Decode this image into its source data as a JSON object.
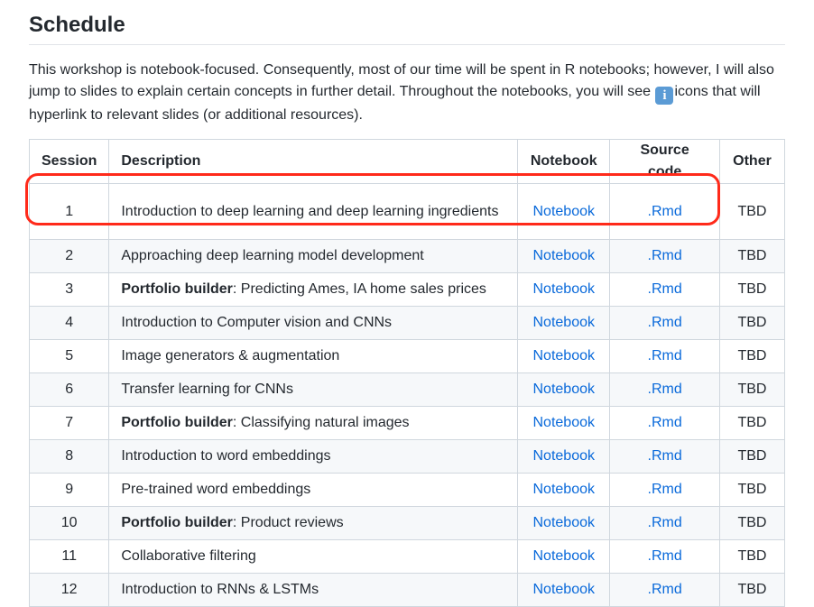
{
  "section": {
    "title": "Schedule"
  },
  "intro": {
    "text_before": "This workshop is notebook-focused. Consequently, most of our time will be spent in R notebooks; however, I will also jump to slides to explain certain concepts in further detail. Throughout the notebooks, you will see ",
    "icon": "info-icon",
    "icon_glyph": "i",
    "text_after": "icons that will hyperlink to relevant slides (or additional resources)."
  },
  "table": {
    "headers": {
      "session": "Session",
      "description": "Description",
      "notebook": "Notebook",
      "source": "Source code",
      "other": "Other"
    },
    "rows": [
      {
        "session": "1",
        "bold": "",
        "description": "Introduction to deep learning and deep learning ingredients",
        "notebook": "Notebook",
        "source": ".Rmd",
        "other": "TBD"
      },
      {
        "session": "2",
        "bold": "",
        "description": "Approaching deep learning model development",
        "notebook": "Notebook",
        "source": ".Rmd",
        "other": "TBD"
      },
      {
        "session": "3",
        "bold": "Portfolio builder",
        "description": ": Predicting Ames, IA home sales prices",
        "notebook": "Notebook",
        "source": ".Rmd",
        "other": "TBD"
      },
      {
        "session": "4",
        "bold": "",
        "description": "Introduction to Computer vision and CNNs",
        "notebook": "Notebook",
        "source": ".Rmd",
        "other": "TBD"
      },
      {
        "session": "5",
        "bold": "",
        "description": "Image generators & augmentation",
        "notebook": "Notebook",
        "source": ".Rmd",
        "other": "TBD"
      },
      {
        "session": "6",
        "bold": "",
        "description": "Transfer learning for CNNs",
        "notebook": "Notebook",
        "source": ".Rmd",
        "other": "TBD"
      },
      {
        "session": "7",
        "bold": "Portfolio builder",
        "description": ": Classifying natural images",
        "notebook": "Notebook",
        "source": ".Rmd",
        "other": "TBD"
      },
      {
        "session": "8",
        "bold": "",
        "description": "Introduction to word embeddings",
        "notebook": "Notebook",
        "source": ".Rmd",
        "other": "TBD"
      },
      {
        "session": "9",
        "bold": "",
        "description": "Pre-trained word embeddings",
        "notebook": "Notebook",
        "source": ".Rmd",
        "other": "TBD"
      },
      {
        "session": "10",
        "bold": "Portfolio builder",
        "description": ": Product reviews",
        "notebook": "Notebook",
        "source": ".Rmd",
        "other": "TBD"
      },
      {
        "session": "11",
        "bold": "",
        "description": "Collaborative filtering",
        "notebook": "Notebook",
        "source": ".Rmd",
        "other": "TBD"
      },
      {
        "session": "12",
        "bold": "",
        "description": "Introduction to RNNs & LSTMs",
        "notebook": "Notebook",
        "source": ".Rmd",
        "other": "TBD"
      }
    ]
  },
  "annotation": {
    "highlighted_row": "1",
    "color": "#ff2a1a"
  },
  "colors": {
    "link": "#0969da",
    "stripe": "#f6f8fa",
    "border": "#d0d7de"
  }
}
